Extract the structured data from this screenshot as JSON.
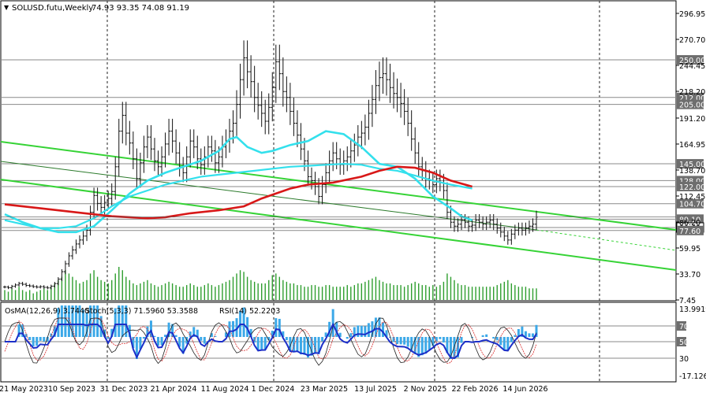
{
  "header": {
    "symbol": "SOLUSD.futu,Weekly",
    "ohlc": "74.93 93.35 74.08 91.19"
  },
  "indicators_header": {
    "osma": "OsMA(12,26,9) 3.7440",
    "stoch": "Stoch(5,3,3) 71.5960 53.3588",
    "rsi": "RSI(14) 52.2203"
  },
  "colors": {
    "price_bars": "#111111",
    "volume": "#2e9e2e",
    "ma_red": "#d81818",
    "ma_cyan": "#33e0ec",
    "ma_green_line": "#33cc33",
    "channel": "#36d336",
    "histogram": "#3ba8e8",
    "rsi": "#1c2fc8",
    "stoch_main": "#202020",
    "stoch_signal": "#d82828",
    "hline": "#8a8a8a",
    "price_badge": "#6e6e6e"
  },
  "chart_data": {
    "type": "line",
    "timeframe": "Weekly",
    "x_ticks": [
      "21 May 2023",
      "10 Sep 2023",
      "31 Dec 2023",
      "21 Apr 2024",
      "11 Aug 2024",
      "1 Dec 2024",
      "23 Mar 2025",
      "13 Jul 2025",
      "2 Nov 2025",
      "22 Feb 2026",
      "14 Jun 2026"
    ],
    "y_ticks": [
      "296.95",
      "270.70",
      "244.45",
      "218.20",
      "191.20",
      "164.95",
      "138.70",
      "112.45",
      "86.20",
      "59.95",
      "33.70",
      "7.45"
    ],
    "ylim": [
      7.45,
      296.95
    ],
    "level_labels": [
      "250.00",
      "212.00",
      "205.00",
      "145.00",
      "128.00",
      "122.00",
      "104.70",
      "89.10",
      "80.63",
      "77.60"
    ],
    "levels": [
      250.0,
      212.0,
      205.0,
      145.0,
      128.0,
      122.0,
      104.7,
      89.1,
      80.63,
      77.6
    ],
    "price_close": [
      20.5,
      19.8,
      21.2,
      22.6,
      24.1,
      23.3,
      22.1,
      21.6,
      20.9,
      20.4,
      20.9,
      20.2,
      19.6,
      21.4,
      24.0,
      28.5,
      36.0,
      44.0,
      52.0,
      58.0,
      64.0,
      68.0,
      72.0,
      78.0,
      96.0,
      113.0,
      105.0,
      101.0,
      106.0,
      110.0,
      117.0,
      142.0,
      178.0,
      194.0,
      176.0,
      166.0,
      150.0,
      130.0,
      146.0,
      162.0,
      172.0,
      160.0,
      148.0,
      142.0,
      152.0,
      165.0,
      178.0,
      168.0,
      156.0,
      142.0,
      136.0,
      152.0,
      168.0,
      162.0,
      150.0,
      144.0,
      152.0,
      162.0,
      158.0,
      146.0,
      152.0,
      162.0,
      168.0,
      178.0,
      186.0,
      205.0,
      230.0,
      252.0,
      238.0,
      228.0,
      212.0,
      204.0,
      196.0,
      188.0,
      202.0,
      222.0,
      248.0,
      236.0,
      218.0,
      212.0,
      198.0,
      186.0,
      174.0,
      160.0,
      148.0,
      132.0,
      128.0,
      122.0,
      112.0,
      124.0,
      136.0,
      148.0,
      156.0,
      150.0,
      144.0,
      148.0,
      152.0,
      158.0,
      164.0,
      172.0,
      176.0,
      182.0,
      196.0,
      210.0,
      224.0,
      232.0,
      236.0,
      230.0,
      222.0,
      216.0,
      212.0,
      206.0,
      198.0,
      186.0,
      170.0,
      156.0,
      142.0,
      138.0,
      130.0,
      128.0,
      124.0,
      130.0,
      126.0,
      118.0,
      96.0,
      86.0,
      82.0,
      84.0,
      88.0,
      86.0,
      82.0,
      83.0,
      88.0,
      86.0,
      84.0,
      86.0,
      88.0,
      84.0,
      80.0,
      76.0,
      72.0,
      68.0,
      74.0,
      78.0,
      80.0,
      78.0,
      80.0,
      82.0,
      84.0,
      91.19
    ],
    "volume_rel": [
      0.3,
      0.25,
      0.35,
      0.3,
      0.4,
      0.3,
      0.25,
      0.3,
      0.2,
      0.25,
      0.3,
      0.35,
      0.3,
      0.4,
      0.5,
      0.6,
      0.7,
      0.9,
      0.8,
      0.7,
      0.6,
      0.5,
      0.55,
      0.6,
      0.8,
      0.9,
      0.7,
      0.6,
      0.55,
      0.5,
      0.6,
      0.8,
      1.0,
      0.9,
      0.7,
      0.6,
      0.5,
      0.45,
      0.5,
      0.55,
      0.6,
      0.5,
      0.45,
      0.4,
      0.45,
      0.5,
      0.55,
      0.5,
      0.45,
      0.4,
      0.4,
      0.45,
      0.5,
      0.45,
      0.4,
      0.4,
      0.45,
      0.5,
      0.45,
      0.4,
      0.45,
      0.5,
      0.55,
      0.6,
      0.7,
      0.8,
      0.9,
      0.85,
      0.7,
      0.6,
      0.55,
      0.5,
      0.5,
      0.5,
      0.6,
      0.75,
      0.8,
      0.7,
      0.6,
      0.55,
      0.5,
      0.5,
      0.45,
      0.45,
      0.4,
      0.4,
      0.45,
      0.45,
      0.4,
      0.4,
      0.45,
      0.45,
      0.4,
      0.4,
      0.4,
      0.4,
      0.45,
      0.4,
      0.45,
      0.5,
      0.5,
      0.55,
      0.6,
      0.65,
      0.7,
      0.6,
      0.55,
      0.5,
      0.5,
      0.45,
      0.45,
      0.45,
      0.4,
      0.45,
      0.5,
      0.55,
      0.5,
      0.45,
      0.45,
      0.4,
      0.45,
      0.4,
      0.45,
      0.55,
      0.8,
      0.7,
      0.6,
      0.5,
      0.45,
      0.45,
      0.4,
      0.4,
      0.4,
      0.4,
      0.4,
      0.4,
      0.4,
      0.4,
      0.45,
      0.5,
      0.55,
      0.6,
      0.5,
      0.45,
      0.4,
      0.4,
      0.4,
      0.35,
      0.35,
      0.35
    ],
    "ma_red": [
      null,
      null,
      null,
      null,
      null,
      null,
      null,
      null,
      null,
      null,
      null,
      null,
      null,
      null,
      null,
      null,
      null,
      null,
      null,
      null,
      null,
      null,
      null,
      null,
      null,
      null,
      null,
      null,
      null,
      null,
      null,
      null,
      null,
      null,
      null,
      null,
      null,
      null,
      null,
      null,
      null,
      null,
      null,
      null,
      null,
      null,
      null,
      null,
      null,
      null,
      null,
      null,
      null,
      null,
      null,
      null,
      null,
      null,
      null,
      null,
      null,
      null,
      null,
      null,
      null,
      null,
      null,
      null,
      null,
      null,
      null,
      null,
      null,
      null,
      null,
      null,
      null,
      null,
      null,
      null,
      null,
      null,
      null,
      null,
      null,
      null,
      null,
      null,
      null,
      null,
      null,
      null,
      null,
      null,
      null,
      null,
      null,
      null,
      null,
      null,
      null,
      null,
      null,
      null,
      null,
      null,
      null,
      null,
      null,
      null,
      null,
      null,
      null,
      null,
      null,
      null,
      null,
      null,
      null,
      null,
      null,
      null,
      null,
      null,
      null,
      null,
      null,
      null,
      null,
      null,
      null,
      null,
      null,
      null,
      null,
      null,
      null,
      null,
      null,
      null,
      null,
      null,
      null,
      null,
      null,
      null,
      null,
      null,
      null,
      null,
      null,
      null,
      null
    ],
    "ma_red_path": [
      [
        0,
        104
      ],
      [
        10,
        100
      ],
      [
        20,
        96
      ],
      [
        30,
        92
      ],
      [
        40,
        90
      ],
      [
        45,
        91
      ],
      [
        52,
        95
      ],
      [
        60,
        98
      ],
      [
        67,
        102
      ],
      [
        72,
        110
      ],
      [
        80,
        120
      ],
      [
        85,
        124
      ],
      [
        92,
        126
      ],
      [
        100,
        132
      ],
      [
        105,
        138
      ],
      [
        110,
        142
      ],
      [
        115,
        141
      ],
      [
        120,
        136
      ],
      [
        125,
        128
      ],
      [
        131,
        122
      ]
    ],
    "ma_cyan_path": [
      [
        0,
        94
      ],
      [
        5,
        86
      ],
      [
        10,
        80
      ],
      [
        15,
        76
      ],
      [
        20,
        76
      ],
      [
        25,
        82
      ],
      [
        30,
        98
      ],
      [
        35,
        115
      ],
      [
        40,
        128
      ],
      [
        45,
        136
      ],
      [
        50,
        142
      ],
      [
        55,
        148
      ],
      [
        60,
        158
      ],
      [
        63,
        170
      ],
      [
        65,
        172
      ],
      [
        68,
        162
      ],
      [
        72,
        156
      ],
      [
        75,
        158
      ],
      [
        80,
        164
      ],
      [
        85,
        168
      ],
      [
        90,
        178
      ],
      [
        95,
        175
      ],
      [
        100,
        162
      ],
      [
        105,
        145
      ],
      [
        110,
        142
      ],
      [
        115,
        130
      ],
      [
        120,
        112
      ],
      [
        125,
        100
      ],
      [
        128,
        92
      ],
      [
        131,
        88
      ]
    ],
    "ma_green_path": [
      [
        0,
        88
      ],
      [
        5,
        84
      ],
      [
        10,
        80
      ],
      [
        15,
        80
      ],
      [
        20,
        82
      ],
      [
        25,
        90
      ],
      [
        30,
        102
      ],
      [
        35,
        112
      ],
      [
        40,
        118
      ],
      [
        45,
        124
      ],
      [
        50,
        128
      ],
      [
        55,
        132
      ],
      [
        60,
        134
      ],
      [
        65,
        136
      ],
      [
        70,
        138
      ],
      [
        75,
        140
      ],
      [
        80,
        142
      ],
      [
        85,
        143
      ],
      [
        90,
        144
      ],
      [
        95,
        145
      ],
      [
        100,
        144
      ],
      [
        105,
        140
      ],
      [
        110,
        138
      ],
      [
        115,
        133
      ],
      [
        120,
        128
      ],
      [
        125,
        124
      ],
      [
        131,
        120
      ]
    ]
  }
}
